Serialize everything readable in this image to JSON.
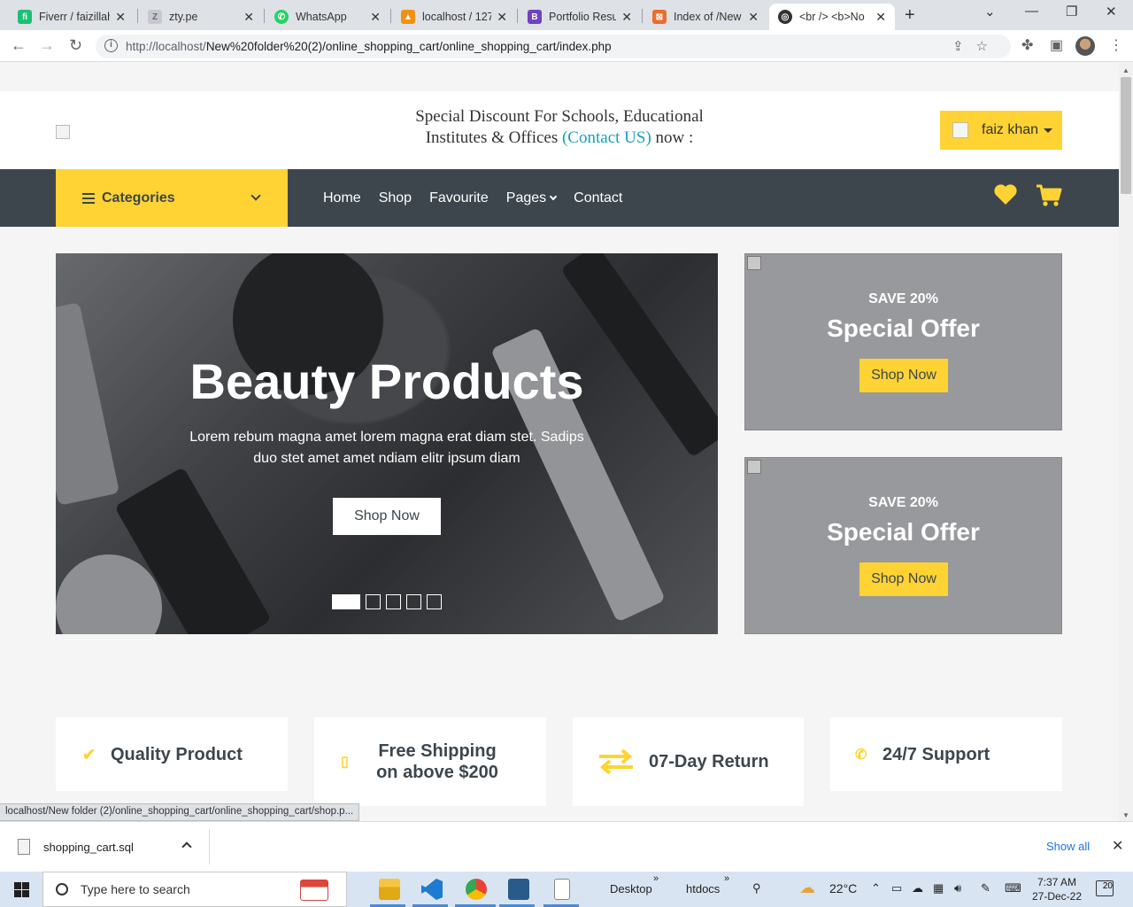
{
  "browser": {
    "tabs": [
      {
        "title": "Fiverr / faizillah",
        "favicon_color": "#1dbf73",
        "favicon_glyph": "fi"
      },
      {
        "title": "zty.pe",
        "favicon_color": "#c8c8d0",
        "favicon_glyph": "Z"
      },
      {
        "title": "WhatsApp",
        "favicon_color": "#25d366",
        "favicon_glyph": "✆"
      },
      {
        "title": "localhost / 127",
        "favicon_color": "#f29111",
        "favicon_glyph": "▲"
      },
      {
        "title": "Portfolio Resum",
        "favicon_color": "#6f42c1",
        "favicon_glyph": "B"
      },
      {
        "title": "Index of /New",
        "favicon_color": "#ec6c2d",
        "favicon_glyph": "⊠"
      },
      {
        "title": "<br /> <b>No",
        "favicon_color": "#333333",
        "favicon_glyph": "◎"
      }
    ],
    "url_host": "http://localhost/",
    "url_path": "New%20folder%20(2)/online_shopping_cart/online_shopping_cart/index.php",
    "status_url": "localhost/New folder (2)/online_shopping_cart/online_shopping_cart/shop.p..."
  },
  "site": {
    "promo_line1": "Special Discount For Schools, Educational",
    "promo_line2": "Institutes & Offices",
    "promo_contact": "(Contact US)",
    "promo_tail": "now :",
    "user_name": "faiz khan",
    "categories_label": "Categories",
    "nav": [
      "Home",
      "Shop",
      "Favourite",
      "Pages",
      "Contact"
    ],
    "hero": {
      "title": "Beauty Products",
      "text": "Lorem rebum magna amet lorem magna erat diam stet. Sadips duo stet amet amet ndiam elitr ipsum diam",
      "button": "Shop Now",
      "slides": 5,
      "active_slide": 1
    },
    "offers": [
      {
        "save": "SAVE 20%",
        "title": "Special Offer",
        "button": "Shop Now"
      },
      {
        "save": "SAVE 20%",
        "title": "Special Offer",
        "button": "Shop Now"
      }
    ],
    "features": [
      {
        "icon": "check-icon",
        "label": "Quality Product"
      },
      {
        "icon": "shipping-icon",
        "label": "Free Shipping on above $200"
      },
      {
        "icon": "exchange-icon",
        "label": "07-Day Return"
      },
      {
        "icon": "phone-icon",
        "label": "24/7 Support"
      }
    ],
    "accent_color": "#ffd333",
    "dark_color": "#3d464d"
  },
  "downloads": {
    "file": "shopping_cart.sql",
    "show_all": "Show all"
  },
  "taskbar": {
    "search_placeholder": "Type here to search",
    "desktop_label": "Desktop",
    "htdocs_label": "htdocs",
    "temperature": "22°C",
    "time": "7:37 AM",
    "date": "27-Dec-22",
    "notifications": "20"
  }
}
